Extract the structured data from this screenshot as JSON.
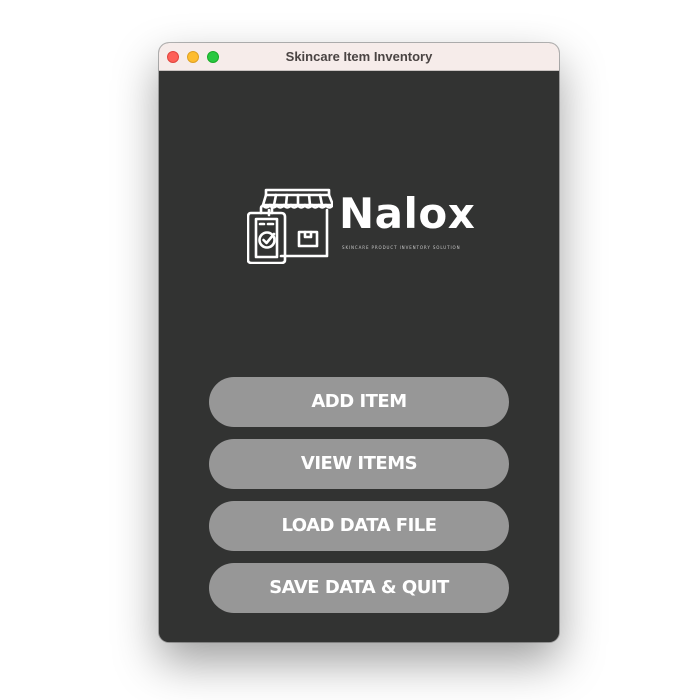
{
  "window": {
    "title": "Skincare Item Inventory"
  },
  "logo": {
    "icon": "storefront-clipboard-icon",
    "name": "Nalox",
    "tagline": "SKINCARE PRODUCT INVENTORY SOLUTION"
  },
  "menu": {
    "add_item": "ADD ITEM",
    "view_items": "VIEW ITEMS",
    "load_data_file": "LOAD DATA FILE",
    "save_quit": "SAVE DATA & QUIT"
  },
  "colors": {
    "background": "#323332",
    "button": "#979797",
    "button_text": "#ffffff",
    "titlebar": "#f6ecea"
  }
}
